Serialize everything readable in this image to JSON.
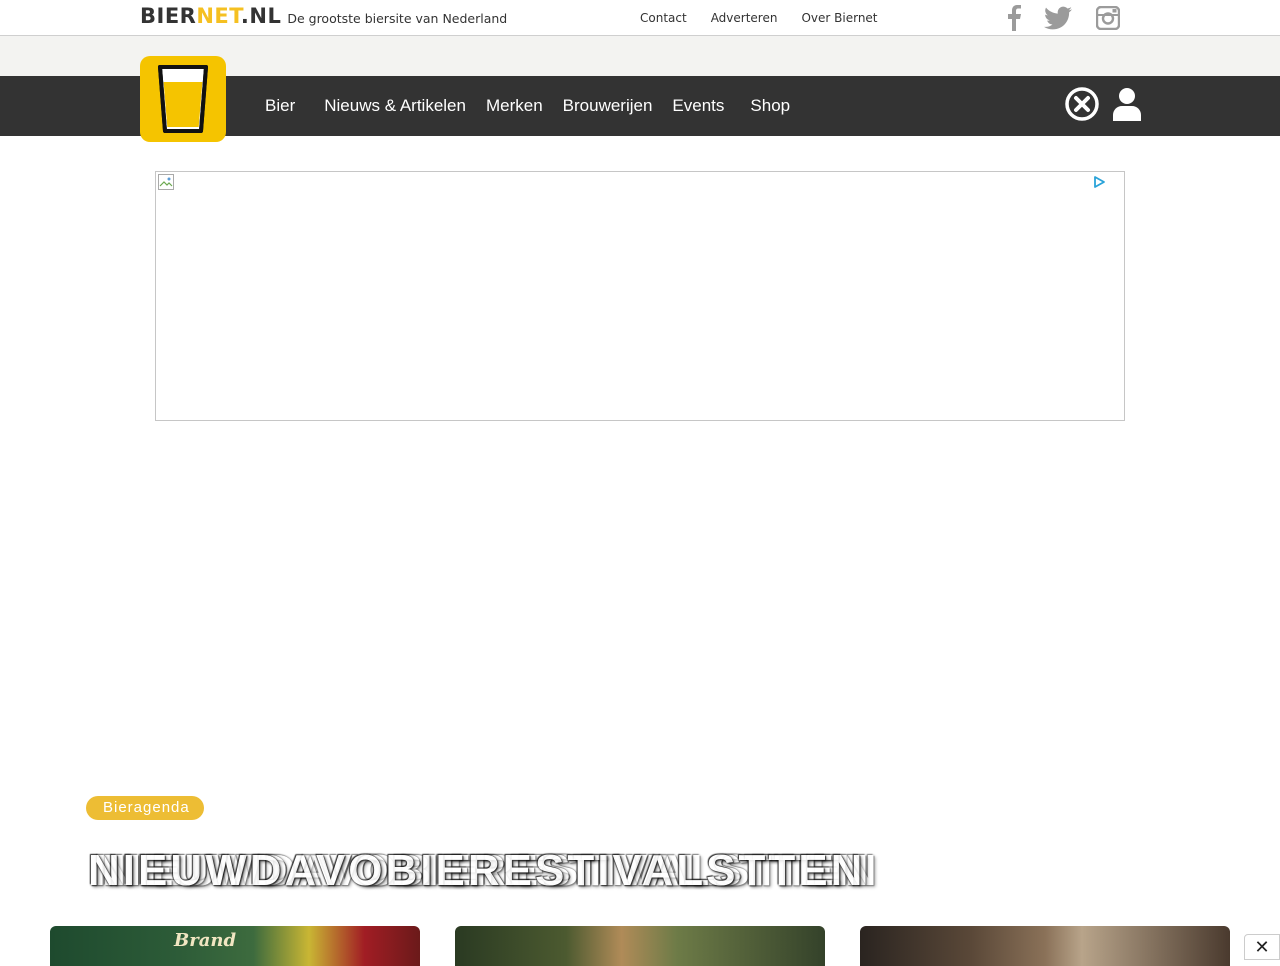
{
  "header": {
    "logo_part1": "BIER",
    "logo_part2": "NET",
    "logo_part3": ".NL",
    "tagline": "De grootste biersite van Nederland",
    "links": [
      "Contact",
      "Adverteren",
      "Over Biernet"
    ],
    "social_icons": [
      "facebook-icon",
      "twitter-icon",
      "instagram-icon"
    ]
  },
  "nav": {
    "items": [
      "Bier",
      "Nieuws & Artikelen",
      "Merken",
      "Brouwerijen",
      "Events",
      "Shop"
    ],
    "right_icons": [
      "close-circle-icon",
      "user-icon"
    ]
  },
  "section": {
    "tag": "Bieragenda",
    "headline_layers": [
      "NIEUWDAVOBIERESTIVALSTTEN",
      "NIEUWDAVOBIERESTIVALSTTEN",
      "NIEUWDAVOBIERESTIVALSTTEN"
    ]
  },
  "cards": {
    "card1_brand": "Brand"
  },
  "overlay": {
    "close": "✕"
  },
  "colors": {
    "accent_yellow": "#f5c400",
    "nav_bg": "#333333",
    "tag_bg": "#edbd34",
    "strip_bg": "#f3f3f1"
  }
}
